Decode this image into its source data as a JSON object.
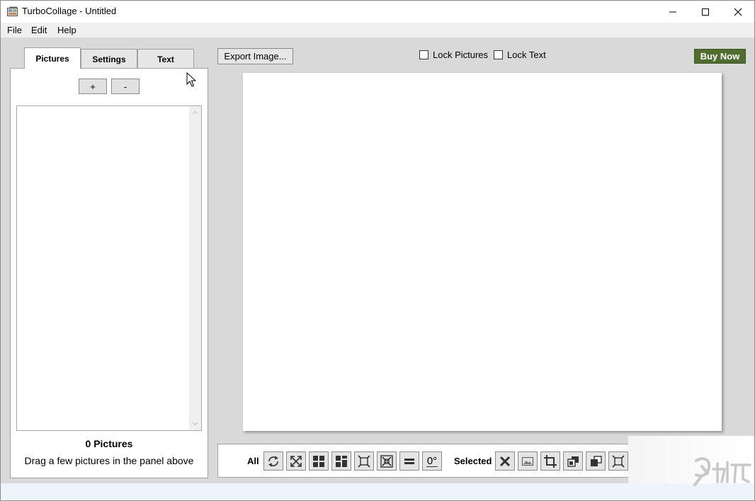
{
  "window": {
    "title": "TurboCollage - Untitled"
  },
  "menu": {
    "items": [
      "File",
      "Edit",
      "Help"
    ]
  },
  "tabs": [
    "Pictures",
    "Settings",
    "Text"
  ],
  "pictures_panel": {
    "add_label": "+",
    "remove_label": "-",
    "count_text": "0 Pictures",
    "hint_text": "Drag a few pictures in the panel above"
  },
  "top_controls": {
    "export_label": "Export Image...",
    "lock_pictures_label": "Lock Pictures",
    "lock_text_label": "Lock Text",
    "lock_pictures_checked": false,
    "lock_text_checked": false,
    "buy_label": "Buy Now"
  },
  "toolbar": {
    "all_label": "All",
    "selected_label": "Selected",
    "rotation_label": "0°",
    "all_icons": [
      "shuffle-icon",
      "expand-all-icon",
      "grid-icon",
      "mosaic-grid-icon",
      "fit-icon",
      "shrink-icon",
      "equal-icon",
      "rotation-icon"
    ],
    "selected_icons": [
      "delete-icon",
      "replace-image-icon",
      "crop-icon",
      "bring-forward-icon",
      "send-backward-icon",
      "fit-selected-icon"
    ]
  },
  "colors": {
    "accent_buy": "#4f6e2d",
    "background": "#d9d9d9",
    "status_bar": "#eef4fb"
  }
}
